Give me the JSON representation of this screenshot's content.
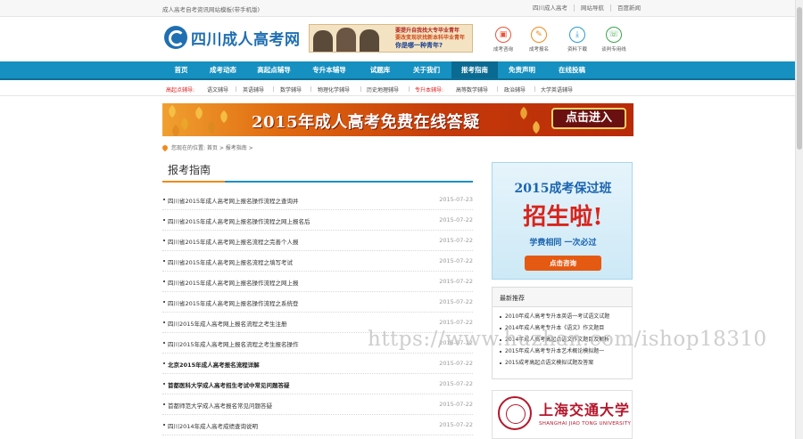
{
  "topbar": {
    "text": "成人高考自考资讯网站模板(带手机版)",
    "links": [
      "四川成人高考",
      "网站导航",
      "百度新闻"
    ]
  },
  "header": {
    "logo_text": "四川成人高考网",
    "banner_lines": [
      "要提升自我找大专毕业青年",
      "要改变现状找新本科毕业青年",
      "你是哪一种青年?"
    ],
    "quick_links": [
      {
        "label": "成考咨询",
        "icon": "chat-icon",
        "color": "#e8553a"
      },
      {
        "label": "成考报名",
        "icon": "edit-icon",
        "color": "#f08a1c"
      },
      {
        "label": "资料下载",
        "icon": "download-icon",
        "color": "#2a9bd1"
      },
      {
        "label": "谈判专用线",
        "icon": "phone-icon",
        "color": "#3aa64a"
      }
    ]
  },
  "nav": {
    "items": [
      "首页",
      "成考动态",
      "高起点辅导",
      "专升本辅导",
      "试题库",
      "关于我们",
      "报考指南",
      "免责声明",
      "在线投稿"
    ],
    "active_index": 6
  },
  "subnav": {
    "items": [
      {
        "label": "高起点辅导:",
        "red": true
      },
      {
        "label": "语文辅导",
        "red": false
      },
      {
        "label": "英语辅导",
        "red": false
      },
      {
        "label": "数学辅导",
        "red": false
      },
      {
        "label": "物理化学辅导",
        "red": false
      },
      {
        "label": "历史地理辅导",
        "red": false
      },
      {
        "label": "专升本辅导:",
        "red": true
      },
      {
        "label": "高等数学辅导",
        "red": false
      },
      {
        "label": "政治辅导",
        "red": false
      },
      {
        "label": "大学英语辅导",
        "red": false
      }
    ]
  },
  "promo": {
    "title": "2015年成人高考免费在线答疑",
    "button": "点击进入"
  },
  "breadcrumb": {
    "text": "您现在的位置: 首页 > 报考指南 >"
  },
  "section": {
    "title": "报考指南"
  },
  "articles": [
    {
      "title": "四川省2015年成人高考网上报名操作流程之查询并",
      "date": "2015-07-23",
      "bold": false
    },
    {
      "title": "四川省2015年成人高考网上报名操作流程之网上报名后",
      "date": "2015-07-22",
      "bold": false
    },
    {
      "title": "四川省2015年成人高考网上报名流程之完善个人报",
      "date": "2015-07-22",
      "bold": false
    },
    {
      "title": "四川省2015年成人高考网上报名流程之填写考试",
      "date": "2015-07-22",
      "bold": false
    },
    {
      "title": "四川省2015年成人高考网上报名操作流程之网上报",
      "date": "2015-07-22",
      "bold": false
    },
    {
      "title": "四川省2015年成人高考网上报名操作流程之系统登",
      "date": "2015-07-22",
      "bold": false
    },
    {
      "title": "四川2015年成人高考网上报名流程之考生注册",
      "date": "2015-07-22",
      "bold": false
    },
    {
      "title": "四川2015年成人高考网上报名流程之考生报名操作",
      "date": "2015-07-22",
      "bold": false
    },
    {
      "title": "北京2015年成人高考报名流程详解",
      "date": "2015-07-22",
      "bold": true
    },
    {
      "title": "首都医科大学成人高考招生考试中常见问题答疑",
      "date": "2015-07-22",
      "bold": true
    },
    {
      "title": "首都师范大学成人高考报名常见问题答疑",
      "date": "2015-07-22",
      "bold": false
    },
    {
      "title": "四川2014年成人高考成绩查询说明",
      "date": "2015-07-22",
      "bold": false
    }
  ],
  "side_ad": {
    "line1": "2015成考保过班",
    "line2": "招生啦!",
    "line3": "学费相同 一次必过",
    "button": "点击咨询"
  },
  "recommend": {
    "title": "最新推荐",
    "items": [
      "2010年成人高考专升本英语一考试语文试题",
      "2014年成人高考专升本《语文》作文题目",
      "2014年成人高考高起点语文作文题目及解析",
      "2015年成人高考专升本艺术概论模拟题一",
      "2015成考高起点语文模拟试题及答案"
    ]
  },
  "university": {
    "name": "上海交通大学",
    "en": "SHANGHAI JIAO TONG UNIVERSITY"
  },
  "watermark": "https://www.huzhan.com/ishop18310"
}
